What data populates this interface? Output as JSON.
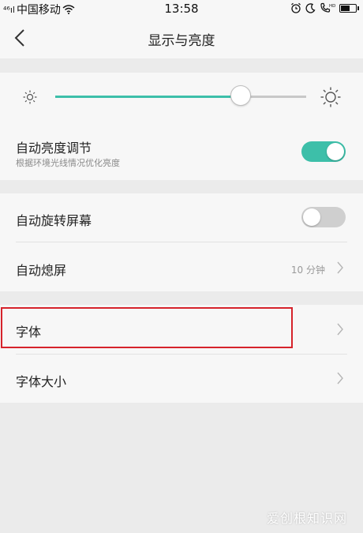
{
  "status_bar": {
    "signal_text": "⁴⁶ıl",
    "carrier": "中国移动",
    "time": "13:58",
    "icons": [
      "wifi-icon",
      "alarm-icon",
      "moon-icon",
      "hd-call-icon",
      "battery-icon"
    ]
  },
  "nav": {
    "back_icon": "chevron-left-icon",
    "title": "显示与亮度"
  },
  "brightness": {
    "low_icon": "sun-small-icon",
    "high_icon": "sun-large-icon",
    "level": 0.74,
    "auto_label": "自动亮度调节",
    "auto_sub": "根据环境光线情况优化亮度",
    "auto_on": true
  },
  "rotation": {
    "label": "自动旋转屏幕",
    "on": false
  },
  "screen_off": {
    "label": "自动熄屏",
    "value": "10 分钟"
  },
  "font": {
    "label": "字体"
  },
  "font_size": {
    "label": "字体大小"
  },
  "watermark": "爱创根知识网",
  "colors": {
    "accent": "#3dbfa9",
    "highlight": "#d6232b",
    "background": "#ebebeb",
    "card": "#f7f7f7"
  }
}
